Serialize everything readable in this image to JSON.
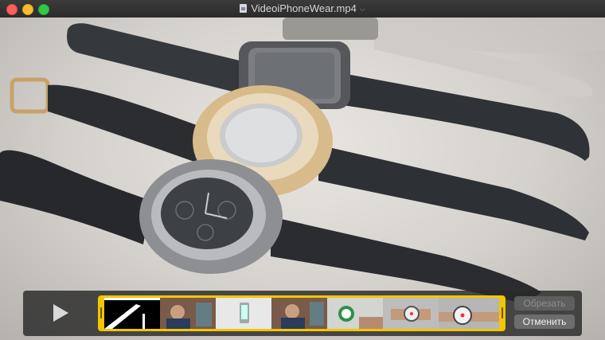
{
  "window": {
    "title": "VideoiPhoneWear.mp4"
  },
  "trim": {
    "trim_label": "Обрезать",
    "cancel_label": "Отменить"
  },
  "colors": {
    "trim_frame": "#f2c600",
    "close": "#fc5f57",
    "minimize": "#fdbc2e",
    "maximize": "#33c748"
  },
  "icons": [
    "document-icon",
    "chevron-down-icon",
    "play-icon"
  ]
}
